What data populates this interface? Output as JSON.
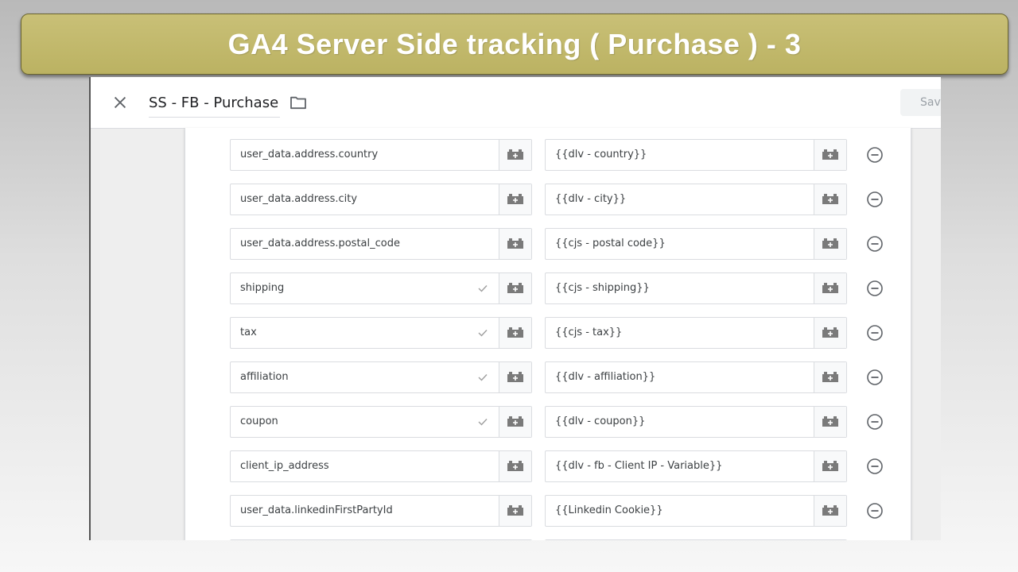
{
  "banner": {
    "title": "GA4 Server Side tracking ( Purchase ) - 3"
  },
  "header": {
    "tag_name": "SS - FB - Purchase",
    "save_label": "Save"
  },
  "rows": [
    {
      "key": "user_data.address.country",
      "value": "{{dlv - country}}",
      "checked": false
    },
    {
      "key": "user_data.address.city",
      "value": "{{dlv - city}}",
      "checked": false
    },
    {
      "key": "user_data.address.postal_code",
      "value": "{{cjs - postal code}}",
      "checked": false
    },
    {
      "key": "shipping",
      "value": "{{cjs - shipping}}",
      "checked": true
    },
    {
      "key": "tax",
      "value": "{{cjs - tax}}",
      "checked": true
    },
    {
      "key": "affiliation",
      "value": "{{dlv - affiliation}}",
      "checked": true
    },
    {
      "key": "coupon",
      "value": "{{dlv - coupon}}",
      "checked": true
    },
    {
      "key": "client_ip_address",
      "value": "{{dlv - fb - Client IP - Variable}}",
      "checked": false
    },
    {
      "key": "user_data.linkedinFirstPartyId",
      "value": "{{Linkedin Cookie}}",
      "checked": false
    },
    {
      "key": "",
      "value": "",
      "checked": false
    }
  ],
  "icons": {
    "close": "close-icon",
    "folder": "folder-icon",
    "variable": "variable-picker-icon",
    "check": "check-icon",
    "remove": "remove-circle-icon"
  },
  "colors": {
    "banner": "#c4bb6f",
    "banner_text": "#ffffff",
    "icon_gray": "#757575"
  }
}
